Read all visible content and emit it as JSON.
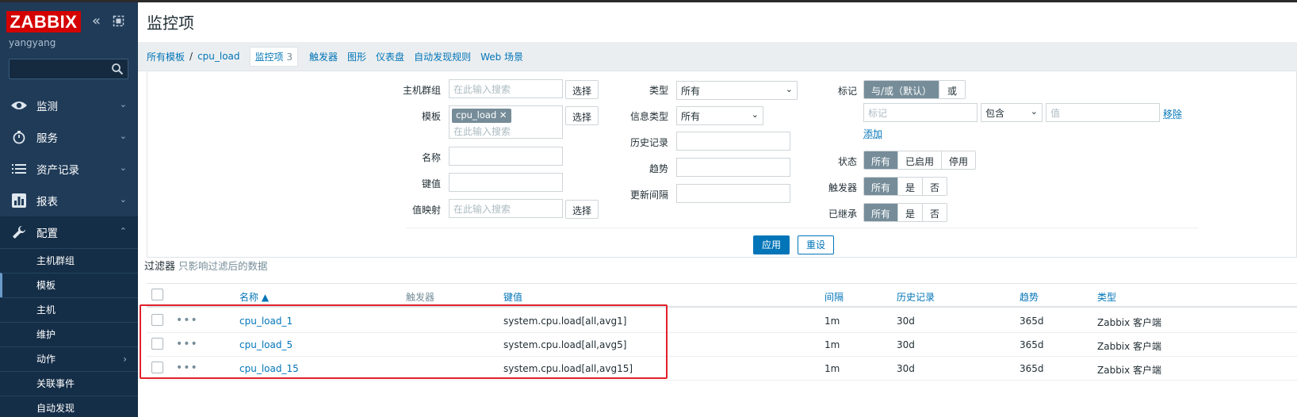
{
  "sidebar": {
    "logo": "ZABBIX",
    "username": "yangyang",
    "search_placeholder": "",
    "menu": [
      {
        "label": "监测",
        "icon": "eye-icon"
      },
      {
        "label": "服务",
        "icon": "stopwatch-icon"
      },
      {
        "label": "资产记录",
        "icon": "list-icon"
      },
      {
        "label": "报表",
        "icon": "bar-chart-icon"
      },
      {
        "label": "配置",
        "icon": "wrench-icon"
      }
    ],
    "submenu": [
      {
        "label": "主机群组"
      },
      {
        "label": "模板"
      },
      {
        "label": "主机"
      },
      {
        "label": "维护"
      },
      {
        "label": "动作"
      },
      {
        "label": "关联事件"
      },
      {
        "label": "自动发现"
      }
    ]
  },
  "page": {
    "title": "监控项"
  },
  "breadcrumbs": {
    "all_templates": "所有模板",
    "separator": "/",
    "template": "cpu_load",
    "items": "监控项",
    "items_count": "3",
    "triggers": "触发器",
    "graphs": "图形",
    "dashboards": "仪表盘",
    "discovery": "自动发现规则",
    "web": "Web 场景"
  },
  "filter": {
    "host_group_label": "主机群组",
    "host_group_placeholder": "在此输入搜索",
    "select_label": "选择",
    "template_label": "模板",
    "template_tag": "cpu_load",
    "template_placeholder": "在此输入搜索",
    "name_label": "名称",
    "key_label": "键值",
    "valuemap_label": "值映射",
    "valuemap_placeholder": "在此输入搜索",
    "type_label": "类型",
    "type_value": "所有",
    "info_type_label": "信息类型",
    "info_type_value": "所有",
    "history_label": "历史记录",
    "trends_label": "趋势",
    "interval_label": "更新间隔",
    "tags_label": "标记",
    "tags_and_or": "与/或（默认）",
    "tags_or": "或",
    "tag_placeholder": "标记",
    "tag_operator": "包含",
    "tag_value_placeholder": "值",
    "tag_remove": "移除",
    "tag_add": "添加",
    "state_label": "状态",
    "state_options": [
      "所有",
      "已启用",
      "停用"
    ],
    "trigger_label": "触发器",
    "trigger_options": [
      "所有",
      "是",
      "否"
    ],
    "inherited_label": "已继承",
    "inherited_options": [
      "所有",
      "是",
      "否"
    ],
    "apply": "应用",
    "reset": "重设",
    "caption": "过滤器",
    "caption_hint": "只影响过滤后的数据"
  },
  "table": {
    "headers": {
      "name": "名称 ▲",
      "triggers": "触发器",
      "key": "键值",
      "interval": "间隔",
      "history": "历史记录",
      "trends": "趋势",
      "type": "类型"
    },
    "rows": [
      {
        "name": "cpu_load_1",
        "key": "system.cpu.load[all,avg1]",
        "interval": "1m",
        "history": "30d",
        "trends": "365d",
        "type": "Zabbix 客户端"
      },
      {
        "name": "cpu_load_5",
        "key": "system.cpu.load[all,avg5]",
        "interval": "1m",
        "history": "30d",
        "trends": "365d",
        "type": "Zabbix 客户端"
      },
      {
        "name": "cpu_load_15",
        "key": "system.cpu.load[all,avg15]",
        "interval": "1m",
        "history": "30d",
        "trends": "365d",
        "type": "Zabbix 客户端"
      }
    ],
    "row_menu": "•••"
  },
  "colors": {
    "sidebar": "#1f3b58",
    "logo": "#d40000",
    "link": "#0275b8",
    "highlight": "#e0212b"
  }
}
